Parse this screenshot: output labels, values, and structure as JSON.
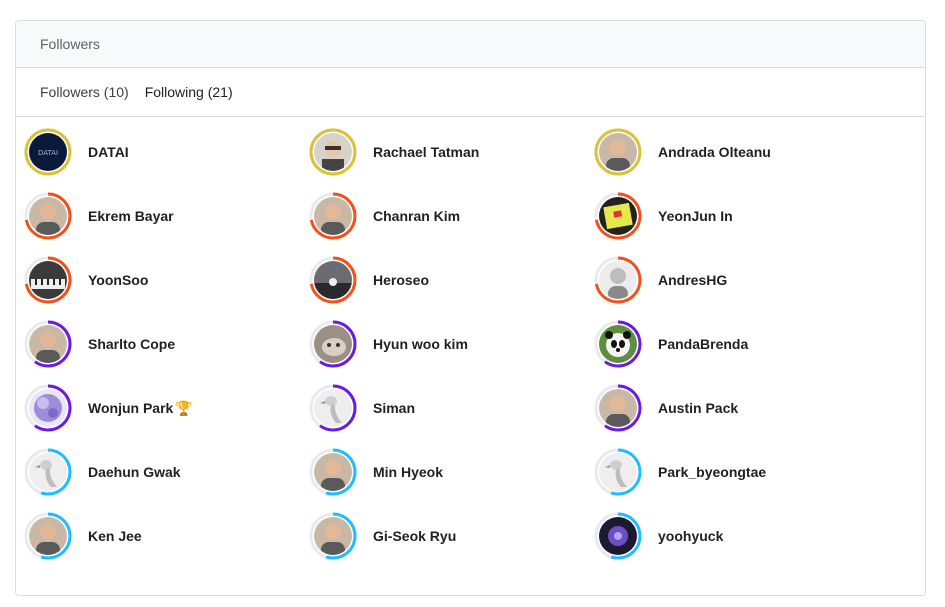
{
  "header": {
    "title": "Followers"
  },
  "tabs": [
    {
      "label": "Followers (10)",
      "active": false
    },
    {
      "label": "Following (21)",
      "active": true
    }
  ],
  "colors": {
    "grandmaster": "#dac23b",
    "master": "#f1511b",
    "expert": "#6b1ce0",
    "contributor": "#20beff",
    "ring_track": "#e8eaed"
  },
  "users": [
    {
      "name": "DATAI",
      "tier": "grandmaster",
      "progress": 1.0,
      "avatar": "datai-logo"
    },
    {
      "name": "Rachael Tatman",
      "tier": "grandmaster",
      "progress": 1.0,
      "avatar": "photo-glasses"
    },
    {
      "name": "Andrada Olteanu",
      "tier": "grandmaster",
      "progress": 1.0,
      "avatar": "photo-portrait"
    },
    {
      "name": "Ekrem Bayar",
      "tier": "master",
      "progress": 0.72,
      "avatar": "photo-portrait"
    },
    {
      "name": "Chanran Kim",
      "tier": "master",
      "progress": 0.72,
      "avatar": "photo-portrait"
    },
    {
      "name": "YeonJun In",
      "tier": "master",
      "progress": 0.72,
      "avatar": "yellow-sign"
    },
    {
      "name": "YoonSoo",
      "tier": "master",
      "progress": 0.72,
      "avatar": "photo-piano"
    },
    {
      "name": "Heroseo",
      "tier": "master",
      "progress": 0.72,
      "avatar": "photo-sunset"
    },
    {
      "name": "AndresHG",
      "tier": "master",
      "progress": 0.72,
      "avatar": "sketch-portrait"
    },
    {
      "name": "Sharlto Cope",
      "tier": "expert",
      "progress": 0.6,
      "avatar": "photo-portrait"
    },
    {
      "name": "Hyun woo kim",
      "tier": "expert",
      "progress": 0.6,
      "avatar": "photo-cat"
    },
    {
      "name": "PandaBrenda",
      "tier": "expert",
      "progress": 0.6,
      "avatar": "panda"
    },
    {
      "name": "Wonjun Park",
      "tier": "expert",
      "progress": 0.6,
      "avatar": "purple-blob",
      "badge": "🏆"
    },
    {
      "name": "Siman",
      "tier": "expert",
      "progress": 0.6,
      "avatar": "goose"
    },
    {
      "name": "Austin Pack",
      "tier": "expert",
      "progress": 0.6,
      "avatar": "photo-portrait"
    },
    {
      "name": "Daehun Gwak",
      "tier": "contributor",
      "progress": 0.55,
      "avatar": "goose"
    },
    {
      "name": "Min Hyeok",
      "tier": "contributor",
      "progress": 0.55,
      "avatar": "photo-portrait"
    },
    {
      "name": "Park_byeongtae",
      "tier": "contributor",
      "progress": 0.55,
      "avatar": "goose"
    },
    {
      "name": "Ken Jee",
      "tier": "contributor",
      "progress": 0.55,
      "avatar": "photo-portrait"
    },
    {
      "name": "Gi-Seok Ryu",
      "tier": "contributor",
      "progress": 0.55,
      "avatar": "photo-portrait"
    },
    {
      "name": "yoohyuck",
      "tier": "contributor",
      "progress": 0.55,
      "avatar": "purple-flower"
    }
  ]
}
